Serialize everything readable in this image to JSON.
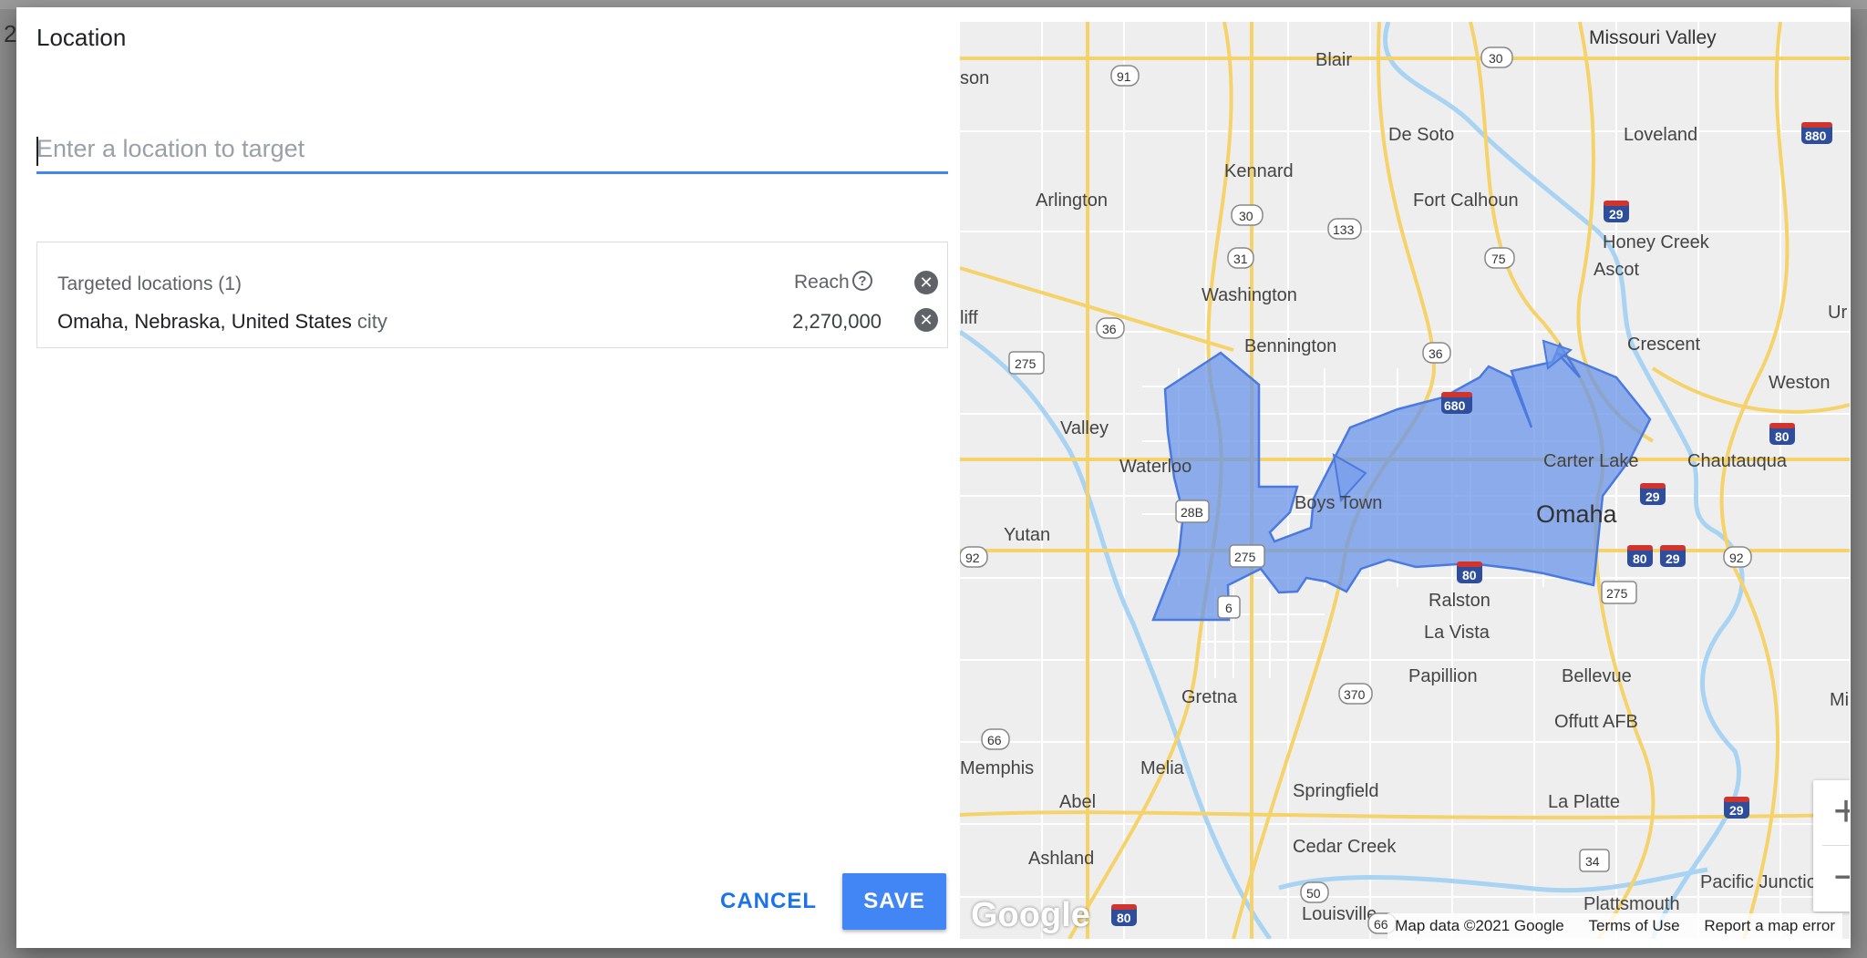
{
  "backdrop_peek": "2",
  "dialog": {
    "title": "Location",
    "search_placeholder": "Enter a location to target",
    "targets": {
      "header": "Targeted locations (1)",
      "reach_label": "Reach",
      "items": [
        {
          "name": "Omaha, Nebraska, United States",
          "type": "city",
          "reach": "2,270,000"
        }
      ]
    },
    "cancel_label": "CANCEL",
    "save_label": "SAVE"
  },
  "map": {
    "logo": "Google",
    "footer": {
      "map_data": "Map data ©2021 Google",
      "terms": "Terms of Use",
      "report": "Report a map error"
    },
    "zoom_in": "+",
    "zoom_out": "−",
    "highlight_color": "#6a94e9",
    "places": [
      "Missouri Valley",
      "Blair",
      "De Soto",
      "Loveland",
      "Kennard",
      "Arlington",
      "Fort Calhoun",
      "Honey Creek",
      "Ascot",
      "Washington",
      "Bennington",
      "Crescent",
      "Weston",
      "Valley",
      "Waterloo",
      "Carter Lake",
      "Chautauqua",
      "Boys Town",
      "Omaha",
      "Yutan",
      "Ralston",
      "La Vista",
      "Papillion",
      "Bellevue",
      "Gretna",
      "Offutt AFB",
      "Memphis",
      "Melia",
      "Springfield",
      "La Platte",
      "Abel",
      "Ashland",
      "Cedar Creek",
      "Pacific Junction",
      "Plattsmouth",
      "Louisville",
      "son",
      "liff",
      "Ur",
      "Mi",
      "G"
    ],
    "road_shields": [
      "30",
      "91",
      "133",
      "30",
      "31",
      "75",
      "36",
      "36",
      "275",
      "28B",
      "275",
      "6",
      "275",
      "370",
      "66",
      "50",
      "34",
      "66",
      "92",
      "92"
    ],
    "interstate_shields": [
      "880",
      "29",
      "680",
      "80",
      "29",
      "80",
      "80",
      "29",
      "80",
      "29",
      "80"
    ]
  }
}
